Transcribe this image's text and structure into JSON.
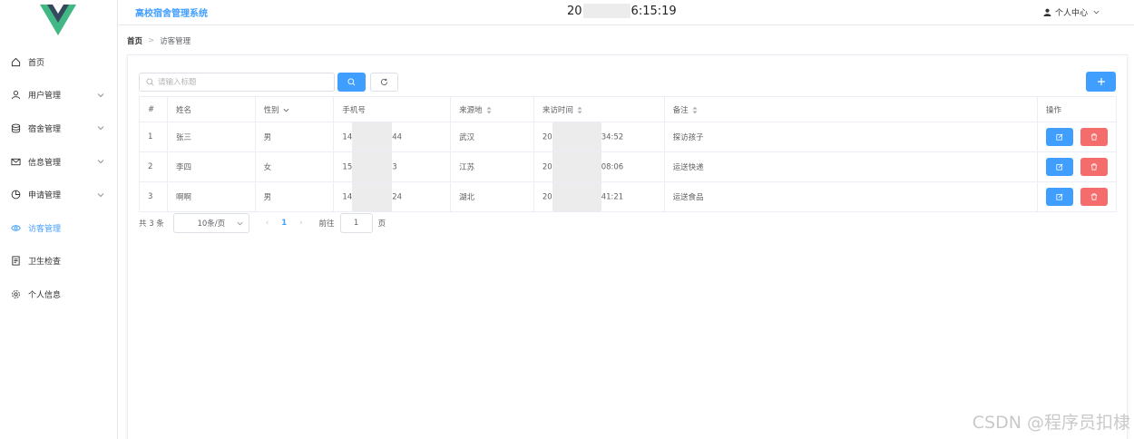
{
  "header": {
    "system_title": "高校宿舍管理系统",
    "clock_prefix": "20",
    "clock_time": "6:15:19",
    "user_label": "个人中心"
  },
  "sidebar": {
    "items": [
      {
        "label": "首页",
        "icon": "home-icon",
        "expandable": false
      },
      {
        "label": "用户管理",
        "icon": "user-icon",
        "expandable": true
      },
      {
        "label": "宿舍管理",
        "icon": "database-icon",
        "expandable": true
      },
      {
        "label": "信息管理",
        "icon": "mail-icon",
        "expandable": true
      },
      {
        "label": "申请管理",
        "icon": "pie-chart-icon",
        "expandable": true
      },
      {
        "label": "访客管理",
        "icon": "eye-icon",
        "expandable": false,
        "active": true
      },
      {
        "label": "卫生检查",
        "icon": "document-icon",
        "expandable": false
      },
      {
        "label": "个人信息",
        "icon": "settings-icon",
        "expandable": false
      }
    ]
  },
  "breadcrumb": {
    "home": "首页",
    "sep": ">",
    "current": "访客管理"
  },
  "search": {
    "placeholder": "请输入标题",
    "value": ""
  },
  "table": {
    "headers": {
      "index": "#",
      "name": "姓名",
      "gender": "性别",
      "phone": "手机号",
      "origin": "来源地",
      "visit_time": "来访时间",
      "remark": "备注",
      "ops": "操作"
    },
    "rows": [
      {
        "index": "1",
        "name": "张三",
        "gender": "男",
        "phone_pre": "14",
        "phone_suf": "44",
        "origin": "武汉",
        "time_pre": "20",
        "time_suf": "34:52",
        "remark": "探访孩子"
      },
      {
        "index": "2",
        "name": "李四",
        "gender": "女",
        "phone_pre": "15",
        "phone_suf": "3",
        "origin": "江苏",
        "time_pre": "20",
        "time_suf": "08:06",
        "remark": "运送快递"
      },
      {
        "index": "3",
        "name": "啊啊",
        "gender": "男",
        "phone_pre": "14",
        "phone_suf": "24",
        "origin": "湖北",
        "time_pre": "20",
        "time_suf": "41:21",
        "remark": "运送食品"
      }
    ]
  },
  "pager": {
    "total": "共 3 条",
    "page_size": "10条/页",
    "prev": "‹",
    "current": "1",
    "next": "›",
    "goto_label": "前往",
    "goto_value": "1",
    "page_suffix": "页"
  },
  "watermark": "CSDN @程序员扣棣",
  "colors": {
    "primary": "#409eff",
    "danger": "#f56c6c",
    "logo_green": "#41b883",
    "logo_dark": "#34495e"
  }
}
